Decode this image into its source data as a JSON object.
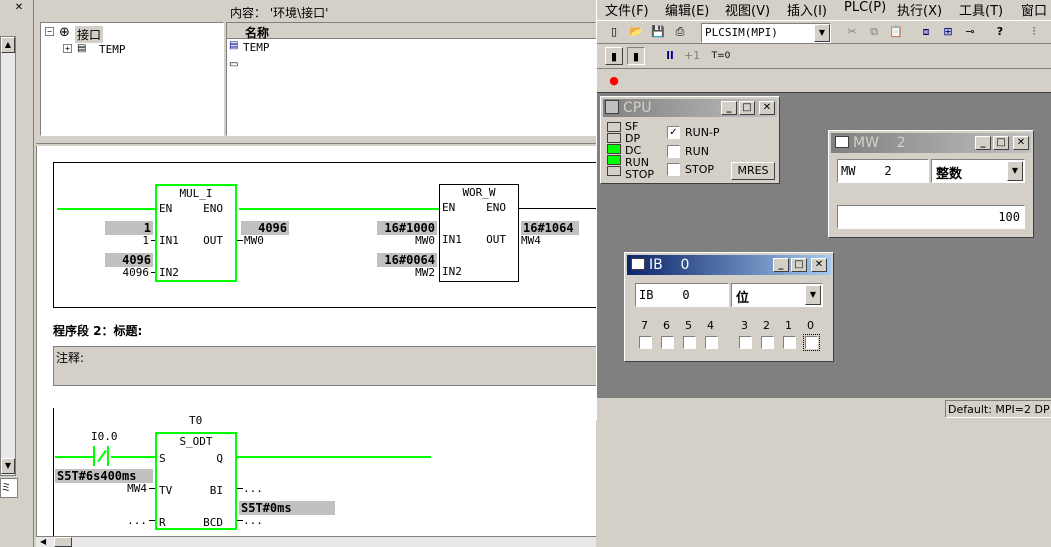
{
  "left_panel": {
    "tree_root": "接口",
    "tree_child": "TEMP",
    "content_header": "内容： '环境\\接口'",
    "col_name": "名称",
    "row1": "TEMP"
  },
  "network1": {
    "mul": {
      "name": "MUL_I",
      "en": "EN",
      "eno": "ENO",
      "in1": "IN1",
      "in2": "IN2",
      "out": "OUT",
      "in1_val": "1",
      "in1_label": "1",
      "in2_val": "4096",
      "in2_label": "4096",
      "out_val": "4096",
      "out_label": "MW0"
    },
    "wor": {
      "name": "WOR_W",
      "en": "EN",
      "eno": "ENO",
      "in1": "IN1",
      "in2": "IN2",
      "out": "OUT",
      "in1_val": "16#1000",
      "in1_label": "MW0",
      "in2_val": "16#0064",
      "in2_label": "MW2",
      "out_val": "16#1064",
      "out_label": "MW4"
    }
  },
  "network2": {
    "title": "程序段 2：标题:",
    "comment": "注释:",
    "timer_label": "T0",
    "contact_label": "I0.0",
    "sodt": {
      "name": "S_ODT",
      "s": "S",
      "q": "Q",
      "tv": "TV",
      "bi": "BI",
      "r": "R",
      "bcd": "BCD"
    },
    "tv_val": "S5T#6s400ms",
    "tv_label": "MW4",
    "r_label": "...",
    "bi_label": "...",
    "bcd_val": "S5T#0ms",
    "bcd_label": "..."
  },
  "plcsim": {
    "menu": [
      "文件(F)",
      "编辑(E)",
      "视图(V)",
      "插入(I)",
      "PLC(P)",
      "执行(X)",
      "工具(T)",
      "窗口"
    ],
    "conn_select": "PLCSIM(MPI)",
    "step_label": "+1",
    "timer_btn": "T=0",
    "status": "Default:  MPI=2 DP"
  },
  "cpu_win": {
    "title": "CPU",
    "leds": [
      "SF",
      "DP",
      "DC",
      "RUN",
      "STOP"
    ],
    "modes": [
      {
        "label": "RUN-P",
        "mark": "✓"
      },
      {
        "label": "RUN",
        "mark": ""
      },
      {
        "label": "STOP",
        "mark": ""
      }
    ],
    "mres": "MRES"
  },
  "mw_win": {
    "title": "MW    2",
    "address": "MW    2",
    "format": "整数",
    "value": "100"
  },
  "ib_win": {
    "title": "IB    0",
    "address": "IB    0",
    "format": "位",
    "bits": [
      "7",
      "6",
      "5",
      "4",
      "3",
      "2",
      "1",
      "0"
    ]
  }
}
